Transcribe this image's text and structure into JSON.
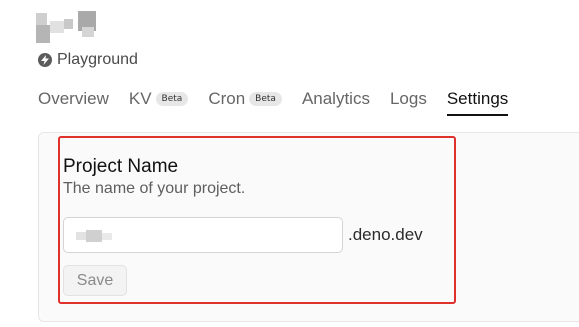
{
  "header": {
    "project_icon": "blurred-project-name",
    "playground": {
      "icon": "bolt-circle-icon",
      "label": "Playground"
    }
  },
  "tabs": [
    {
      "label": "Overview",
      "badge": ""
    },
    {
      "label": "KV",
      "badge": "Beta"
    },
    {
      "label": "Cron",
      "badge": "Beta"
    },
    {
      "label": "Analytics",
      "badge": ""
    },
    {
      "label": "Logs",
      "badge": ""
    },
    {
      "label": "Settings",
      "badge": "",
      "active": true
    }
  ],
  "settings": {
    "project_name": {
      "title": "Project Name",
      "description": "The name of your project.",
      "input_value": "",
      "suffix": ".deno.dev",
      "save_label": "Save"
    }
  },
  "colors": {
    "highlight_border": "#e0302b",
    "card_background": "#fafafa",
    "active_tab": "#111111",
    "inactive_tab": "#666666"
  }
}
